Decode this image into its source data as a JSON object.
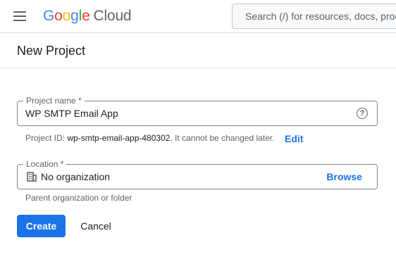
{
  "topbar": {
    "logo": {
      "letters": [
        "G",
        "o",
        "o",
        "g",
        "l",
        "e"
      ],
      "product": "Cloud"
    },
    "search": {
      "placeholder": "Search (/) for resources, docs, products, and more"
    }
  },
  "page": {
    "title": "New Project"
  },
  "form": {
    "project_name": {
      "label": "Project name *",
      "value": "WP SMTP Email App",
      "help_icon": "help-circle-icon"
    },
    "project_id": {
      "prefix": "Project ID: ",
      "value": "wp-smtp-email-app-480302",
      "suffix": ". It cannot be changed later.",
      "edit_label": "Edit"
    },
    "location": {
      "label": "Location *",
      "value": "No organization",
      "icon": "building-icon",
      "browse_label": "Browse",
      "hint": "Parent organization or folder"
    }
  },
  "actions": {
    "create_label": "Create",
    "cancel_label": "Cancel"
  },
  "colors": {
    "primary": "#1a73e8",
    "google_blue": "#4285f4",
    "google_red": "#ea4335",
    "google_yellow": "#fbbc04",
    "google_green": "#34a853",
    "text_primary": "#202124",
    "text_secondary": "#5f6368"
  }
}
